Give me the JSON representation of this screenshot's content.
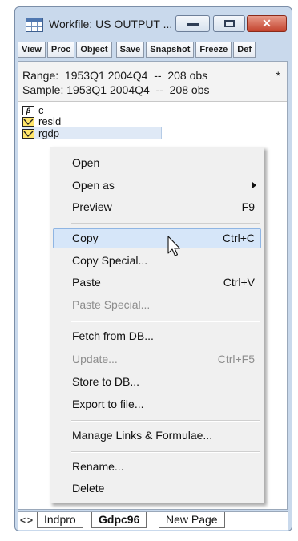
{
  "window": {
    "title": "Workfile: US OUTPUT ...",
    "close_glyph": "✕"
  },
  "toolbar": {
    "buttons": [
      "View",
      "Proc",
      "Object",
      "Save",
      "Snapshot",
      "Freeze",
      "Def"
    ]
  },
  "info": {
    "range_line": "Range:  1953Q1 2004Q4  --  208 obs",
    "sample_line": "Sample: 1953Q1 2004Q4  --  208 obs",
    "modified_marker": "*"
  },
  "objects": [
    {
      "name": "c",
      "icon": "coef-icon",
      "glyph": "β"
    },
    {
      "name": "resid",
      "icon": "series-icon"
    },
    {
      "name": "rgdp",
      "icon": "series-icon",
      "selected": true
    }
  ],
  "context_menu": {
    "items": [
      {
        "label": "Open",
        "shortcut": "",
        "disabled": false
      },
      {
        "label": "Open as",
        "shortcut": "",
        "disabled": false,
        "submenu": true
      },
      {
        "label": "Preview",
        "shortcut": "F9",
        "disabled": false
      },
      {
        "label": "Copy",
        "shortcut": "Ctrl+C",
        "disabled": false,
        "highlighted": true
      },
      {
        "label": "Copy Special...",
        "shortcut": "",
        "disabled": false
      },
      {
        "label": "Paste",
        "shortcut": "Ctrl+V",
        "disabled": false
      },
      {
        "label": "Paste Special...",
        "shortcut": "",
        "disabled": true
      },
      {
        "label": "Fetch from DB...",
        "shortcut": "",
        "disabled": false
      },
      {
        "label": "Update...",
        "shortcut": "Ctrl+F5",
        "disabled": true
      },
      {
        "label": "Store to DB...",
        "shortcut": "",
        "disabled": false
      },
      {
        "label": "Export to file...",
        "shortcut": "",
        "disabled": false
      },
      {
        "label": "Manage Links & Formulae...",
        "shortcut": "",
        "disabled": false
      },
      {
        "label": "Rename...",
        "shortcut": "",
        "disabled": false
      },
      {
        "label": "Delete",
        "shortcut": "",
        "disabled": false
      }
    ]
  },
  "tabs": {
    "nav_prev": "<",
    "nav_next": ">",
    "pages": [
      {
        "label": "Indpro",
        "active": false
      },
      {
        "label": "Gdpc96",
        "active": true
      },
      {
        "label": "New Page",
        "active": false
      }
    ]
  },
  "colors": {
    "frame": "#c9d9ec",
    "menu_highlight": "#d6e6f9",
    "close_button": "#c4442e",
    "series_icon": "#ffe56a"
  }
}
